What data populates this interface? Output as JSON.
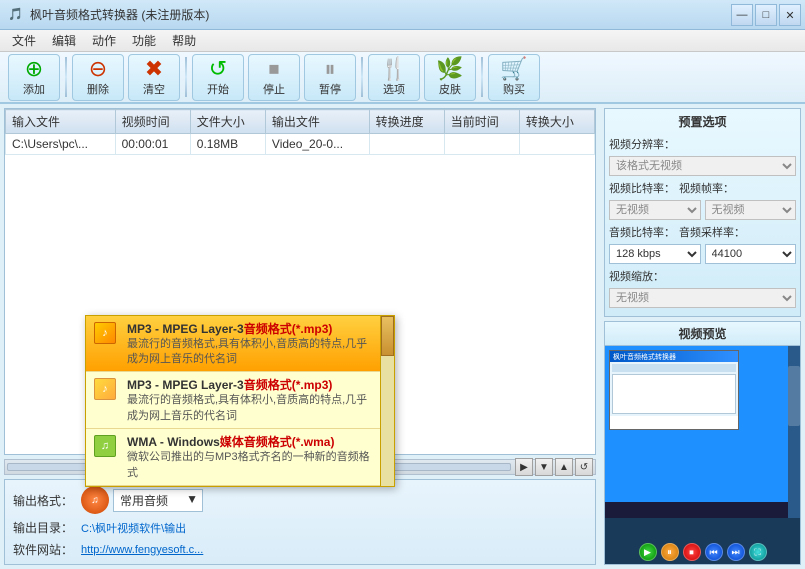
{
  "app": {
    "title": "枫叶音频格式转换器  (未注册版本)",
    "icon": "🎵"
  },
  "titlebar": {
    "minimize": "—",
    "maximize": "□",
    "close": "✕"
  },
  "menubar": {
    "items": [
      "文件",
      "编辑",
      "动作",
      "功能",
      "帮助"
    ]
  },
  "toolbar": {
    "buttons": [
      {
        "id": "add",
        "icon": "⊕",
        "label": "添加",
        "class": "btn-add"
      },
      {
        "id": "delete",
        "icon": "⊖",
        "label": "删除",
        "class": "btn-delete"
      },
      {
        "id": "clear",
        "icon": "✖",
        "label": "清空",
        "class": "btn-clear"
      },
      {
        "id": "start",
        "icon": "↺",
        "label": "开始",
        "class": "btn-start"
      },
      {
        "id": "stop",
        "icon": "⏹",
        "label": "停止",
        "class": "btn-stop"
      },
      {
        "id": "pause",
        "icon": "⏸",
        "label": "暂停",
        "class": "btn-pause"
      },
      {
        "id": "options",
        "icon": "🍴",
        "label": "选项",
        "class": "btn-options"
      },
      {
        "id": "skin",
        "icon": "🌿",
        "label": "皮肤",
        "class": "btn-skin"
      },
      {
        "id": "buy",
        "icon": "🛒",
        "label": "购买",
        "class": "btn-buy"
      }
    ]
  },
  "table": {
    "headers": [
      "输入文件",
      "视频时间",
      "文件大小",
      "输出文件",
      "转换进度",
      "当前时间",
      "转换大小"
    ],
    "rows": [
      {
        "input": "C:\\Users\\pc\\...",
        "duration": "00:00:01",
        "filesize": "0.18MB",
        "output": "Video_20-0...",
        "progress": "",
        "currenttime": "",
        "convertsize": ""
      }
    ]
  },
  "bottom": {
    "format_label": "输出格式：",
    "format_value": "常用音频",
    "dir_label": "输出目录：",
    "dir_value": "C:\\枫叶视频软件\\输出",
    "website_label": "软件网站：",
    "website_value": "http://www.fengyesoft.c..."
  },
  "preset": {
    "title": "预置选项",
    "video_resolution_label": "视频分辨率：",
    "video_resolution_value": "该格式无视频",
    "video_bitrate_label": "视频比特率：",
    "video_bitrate_value": "无视频",
    "video_fps_label": "视频帧率：",
    "video_fps_value": "无视频",
    "audio_bitrate_label": "音频比特率：",
    "audio_bitrate_value": "128 kbps",
    "audio_samplerate_label": "音频采样率：",
    "audio_samplerate_value": "44100",
    "video_scale_label": "视频缩放：",
    "video_scale_value": "无视频"
  },
  "preview": {
    "title": "视频预览"
  },
  "dropdown": {
    "items": [
      {
        "id": "mp3-1",
        "title_plain": "MP3 - MPEG Layer-3",
        "title_highlight": "音频格式(*.mp3)",
        "description": "最流行的音频格式,具有体积小,音质高的特点,几乎成为网上音乐的代名词",
        "selected": true
      },
      {
        "id": "mp3-2",
        "title_plain": "MP3 - MPEG Layer-3",
        "title_highlight": "音频格式(*.mp3)",
        "description": "最流行的音频格式,具有体积小,音质高的特点,几乎成为网上音乐的代名词",
        "selected": false
      },
      {
        "id": "wma",
        "title_plain": "WMA - Windows",
        "title_highlight": "媒体音频格式(*.wma)",
        "description": "微软公司推出的与MP3格式齐名的一种新的音频格式",
        "selected": false
      }
    ]
  }
}
